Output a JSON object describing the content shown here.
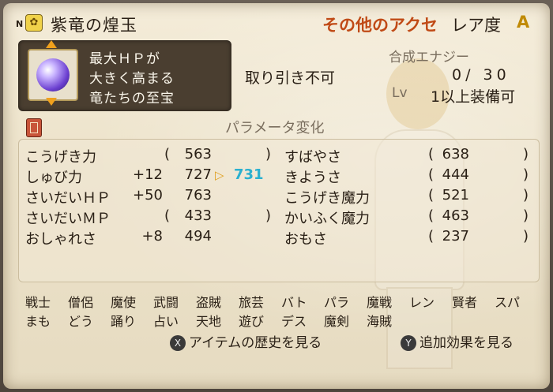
{
  "header": {
    "n_mark": "N",
    "key_icon": "key-icon",
    "item_name": "紫竜の煌玉",
    "category": "その他のアクセ",
    "rarity_label": "レア度",
    "rarity_value": "A"
  },
  "description": {
    "lines": [
      "最大ＨＰが",
      "大きく高まる",
      "竜たちの至宝"
    ]
  },
  "info": {
    "trade": "取り引き不可",
    "synth_label": "合成エナジー",
    "synth_value": "0/ 30",
    "lv_label": "Lv",
    "lv_value": "1以上装備可"
  },
  "params": {
    "header": "パラメータ変化",
    "left": [
      {
        "name": "こうげき力",
        "bonus": "",
        "value": "563",
        "new": ""
      },
      {
        "name": "しゅび力",
        "bonus": "+12",
        "value": "727",
        "new": "731"
      },
      {
        "name": "さいだいＨＰ",
        "bonus": "+50",
        "value": "763",
        "new": ""
      },
      {
        "name": "さいだいＭＰ",
        "bonus": "",
        "value": "433",
        "new": ""
      },
      {
        "name": "おしゃれさ",
        "bonus": "+8",
        "value": "494",
        "new": ""
      }
    ],
    "right": [
      {
        "name": "すばやさ",
        "value": "638"
      },
      {
        "name": "きようさ",
        "value": "444"
      },
      {
        "name": "こうげき魔力",
        "value": "521"
      },
      {
        "name": "かいふく魔力",
        "value": "463"
      },
      {
        "name": "おもさ",
        "value": "237"
      }
    ]
  },
  "jobs": {
    "row1": [
      "戦士",
      "僧侶",
      "魔使",
      "武闘",
      "盗賊",
      "旅芸",
      "バト",
      "パラ",
      "魔戦",
      "レン",
      "賢者",
      "スパ"
    ],
    "row2": [
      "まも",
      "どう",
      "踊り",
      "占い",
      "天地",
      "遊び",
      "デス",
      "魔剣",
      "海賊"
    ]
  },
  "buttons": {
    "x_key": "X",
    "x_label": "アイテムの歴史を見る",
    "y_key": "Y",
    "y_label": "追加効果を見る"
  },
  "colors": {
    "category": "#c04a16",
    "rarity": "#c08a06",
    "new_value": "#2ab0cf",
    "arrow": "#e0a020"
  }
}
